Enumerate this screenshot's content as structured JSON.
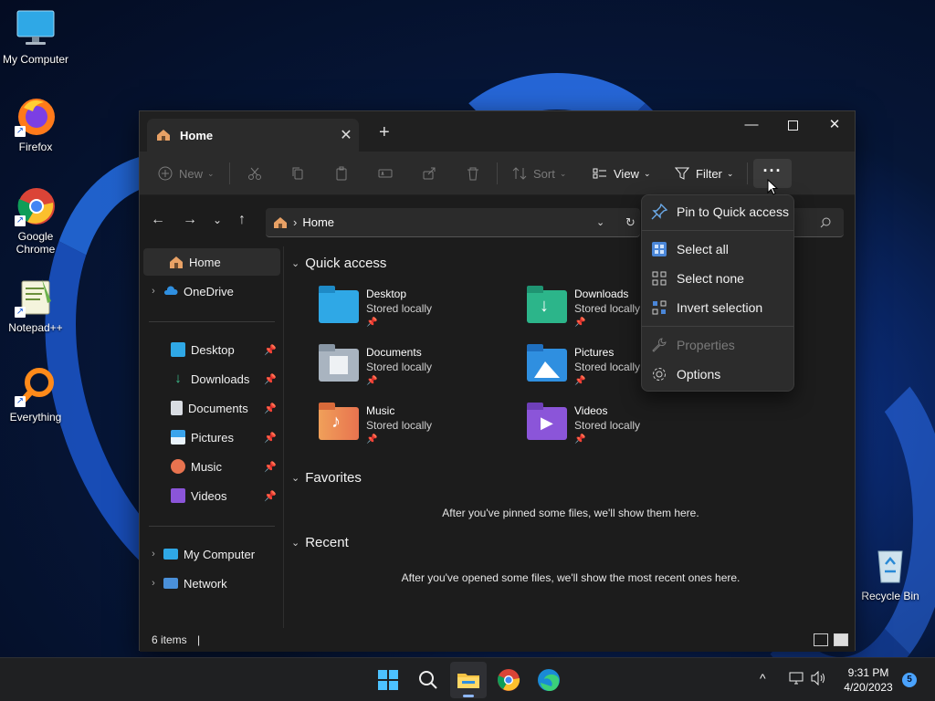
{
  "desktop": {
    "icons": [
      {
        "label": "My Computer"
      },
      {
        "label": "Firefox"
      },
      {
        "label": "Google Chrome"
      },
      {
        "label": "Notepad++"
      },
      {
        "label": "Everything"
      },
      {
        "label": "Recycle Bin"
      }
    ]
  },
  "explorer": {
    "tab_title": "Home",
    "commands": {
      "new": "New",
      "sort": "Sort",
      "view": "View",
      "filter": "Filter",
      "more": "···"
    },
    "address": {
      "path": "Home"
    },
    "nav": {
      "top": [
        {
          "label": "Home"
        },
        {
          "label": "OneDrive"
        }
      ],
      "pinned": [
        {
          "label": "Desktop"
        },
        {
          "label": "Downloads"
        },
        {
          "label": "Documents"
        },
        {
          "label": "Pictures"
        },
        {
          "label": "Music"
        },
        {
          "label": "Videos"
        }
      ],
      "bottom": [
        {
          "label": "My Computer"
        },
        {
          "label": "Network"
        }
      ]
    },
    "sections": {
      "quick_access": "Quick access",
      "favorites": "Favorites",
      "recent": "Recent"
    },
    "quick_access_items": [
      {
        "name": "Desktop",
        "status": "Stored locally"
      },
      {
        "name": "Downloads",
        "status": "Stored locally"
      },
      {
        "name": "Documents",
        "status": "Stored locally"
      },
      {
        "name": "Pictures",
        "status": "Stored locally"
      },
      {
        "name": "Music",
        "status": "Stored locally"
      },
      {
        "name": "Videos",
        "status": "Stored locally"
      }
    ],
    "favorites_empty": "After you've pinned some files, we'll show them here.",
    "recent_empty": "After you've opened some files, we'll show the most recent ones here.",
    "status": {
      "items": "6 items"
    }
  },
  "more_menu": {
    "items": [
      {
        "label": "Pin to Quick access",
        "enabled": true
      },
      {
        "label": "Select all",
        "enabled": true
      },
      {
        "label": "Select none",
        "enabled": true
      },
      {
        "label": "Invert selection",
        "enabled": true
      },
      {
        "label": "Properties",
        "enabled": false
      },
      {
        "label": "Options",
        "enabled": true
      }
    ]
  },
  "taskbar": {
    "clock_time": "9:31 PM",
    "clock_date": "4/20/2023",
    "notification_count": "5"
  },
  "colors": {
    "accent": "#4aa3ff",
    "window_bg": "#1c1c1c",
    "menu_bg": "#2c2c2c"
  }
}
